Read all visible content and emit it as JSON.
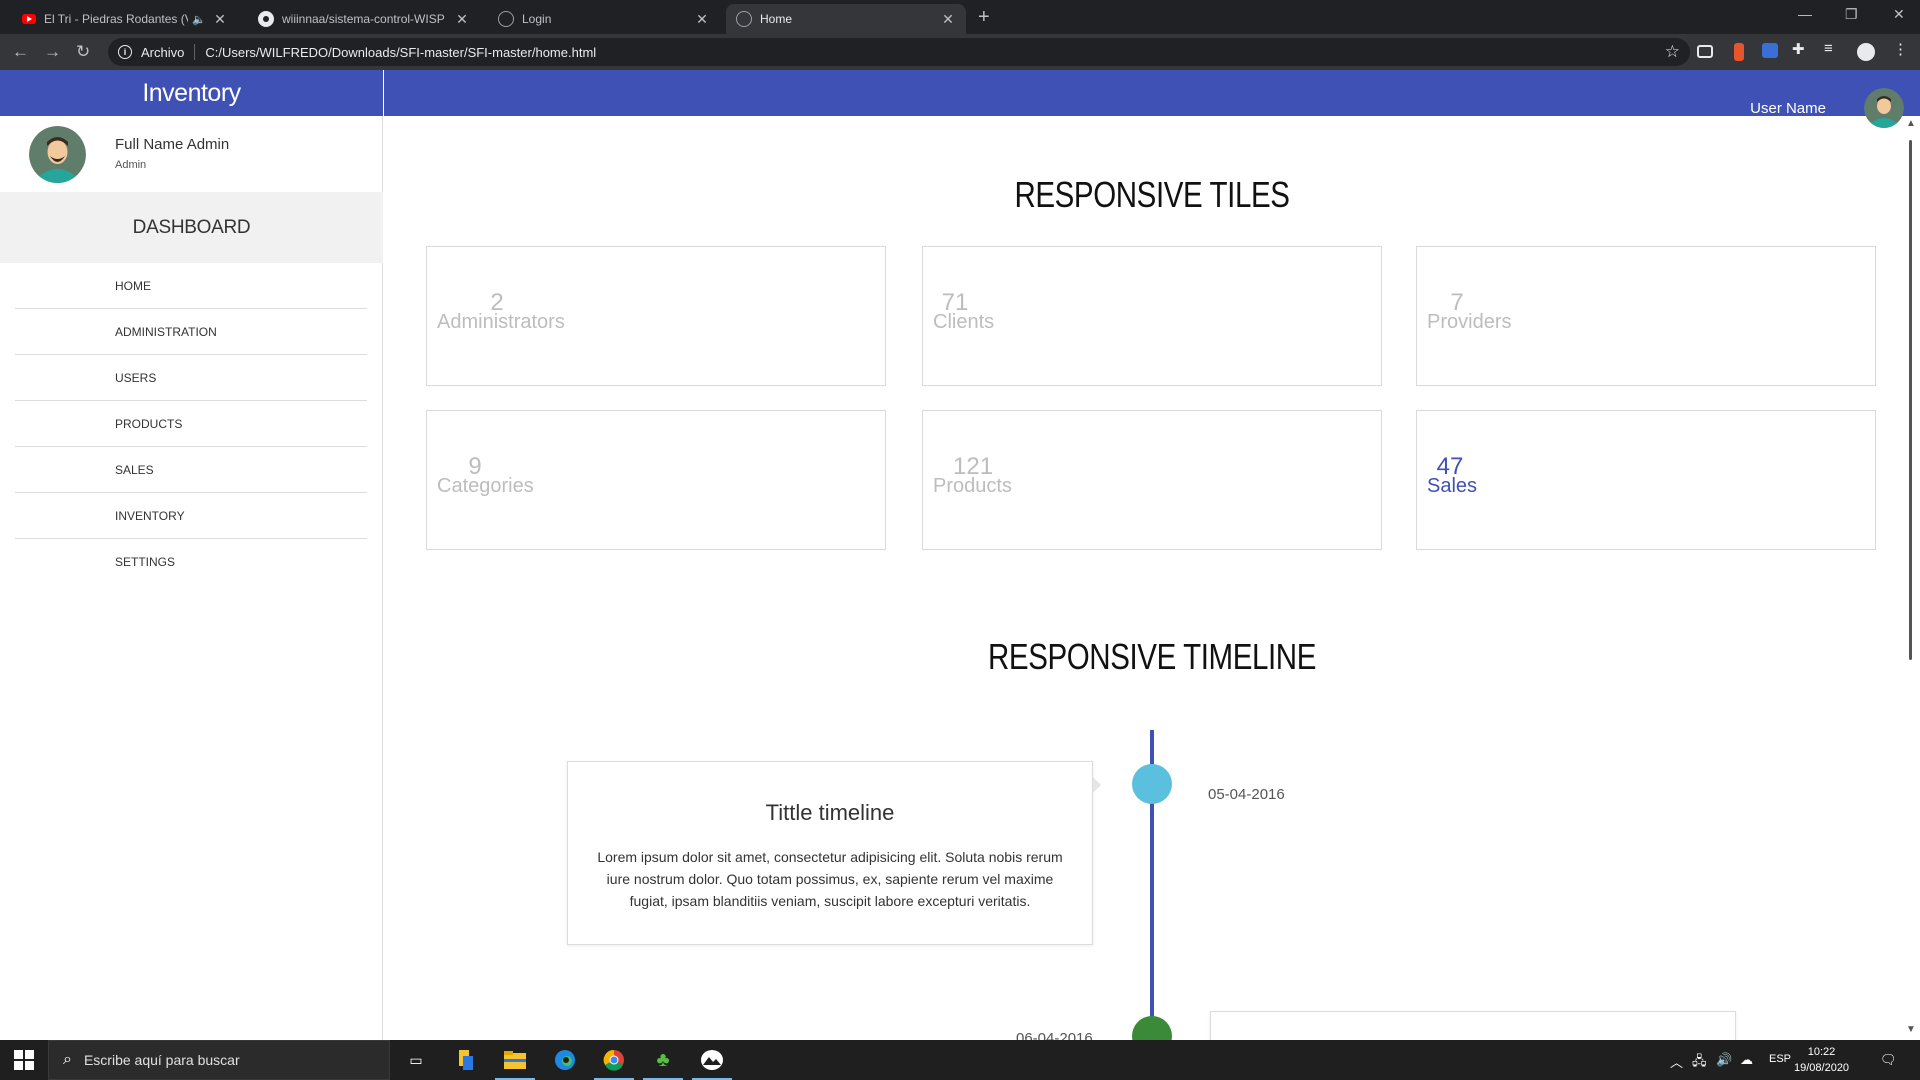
{
  "browser": {
    "tabs": [
      {
        "label": "El Tri - Piedras Rodantes (Vid",
        "favicon": "youtube-icon",
        "active": false
      },
      {
        "label": "wiiinnaa/sistema-control-WISP",
        "favicon": "github-icon",
        "active": false
      },
      {
        "label": "Login",
        "favicon": "globe-icon",
        "active": false
      },
      {
        "label": "Home",
        "favicon": "globe-icon",
        "active": true
      }
    ],
    "url_scheme": "Archivo",
    "url": "C:/Users/WILFREDO/Downloads/SFI-master/SFI-master/home.html"
  },
  "app": {
    "brand": "Inventory",
    "user_name": "User Name"
  },
  "sidebar": {
    "full_name": "Full Name Admin",
    "role": "Admin",
    "section": "DASHBOARD",
    "items": [
      "HOME",
      "ADMINISTRATION",
      "USERS",
      "PRODUCTS",
      "SALES",
      "INVENTORY",
      "SETTINGS"
    ]
  },
  "tiles_section": {
    "title": "RESPONSIVE TILES",
    "tiles": [
      {
        "value": "2",
        "label": "Administrators",
        "highlight": false
      },
      {
        "value": "71",
        "label": "Clients",
        "highlight": false
      },
      {
        "value": "7",
        "label": "Providers",
        "highlight": false
      },
      {
        "value": "9",
        "label": "Categories",
        "highlight": false
      },
      {
        "value": "121",
        "label": "Products",
        "highlight": false
      },
      {
        "value": "47",
        "label": "Sales",
        "highlight": true
      }
    ]
  },
  "timeline_section": {
    "title": "RESPONSIVE TIMELINE",
    "entries": [
      {
        "date": "05-04-2016",
        "title": "Tittle timeline",
        "body": "Lorem ipsum dolor sit amet, consectetur adipisicing elit. Soluta nobis rerum iure nostrum dolor. Quo totam possimus, ex, sapiente rerum vel maxime fugiat, ipsam blanditiis veniam, suscipit labore excepturi veritatis.",
        "dot_color": "#5bc0de"
      },
      {
        "date": "06-04-2016",
        "dot_color": "#3a8a3a"
      }
    ]
  },
  "taskbar": {
    "search_placeholder": "Escribe aquí para buscar",
    "language": "ESP",
    "time": "10:22",
    "date": "19/08/2020"
  },
  "colors": {
    "primary": "#3f51b5",
    "tile_text": "#bdbdbd",
    "timeline_dot_1": "#5bc0de",
    "timeline_dot_2": "#3a8a3a"
  }
}
